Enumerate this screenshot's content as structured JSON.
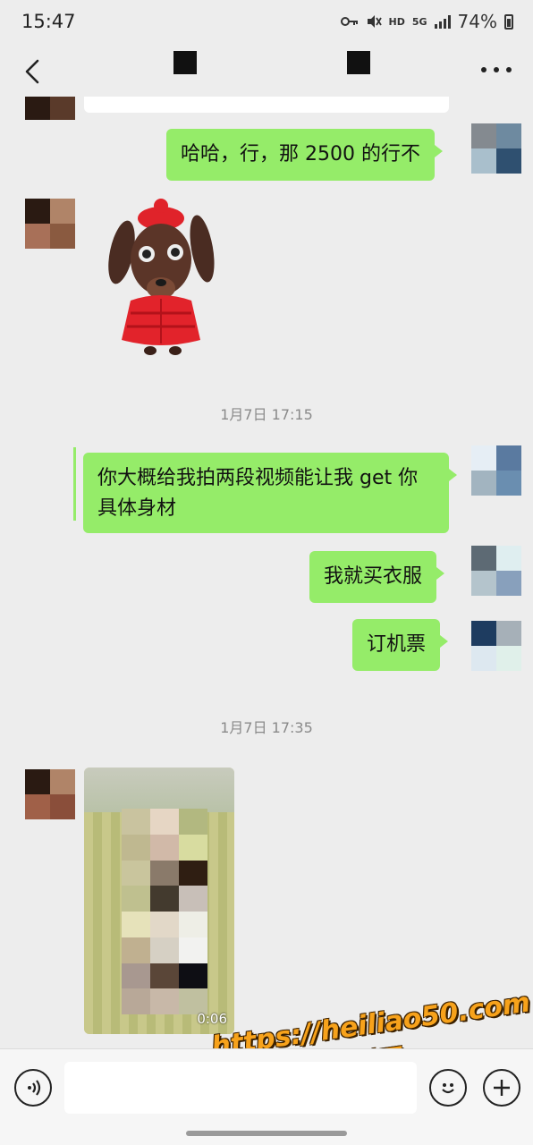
{
  "status_bar": {
    "time": "15:47",
    "hd": "HD",
    "net": "5G",
    "battery": "74%"
  },
  "nav": {
    "back_icon": "chevron-left-icon",
    "more_icon": "more-dots-icon"
  },
  "messages": [
    {
      "type": "text",
      "side": "sent",
      "text": "哈哈，行，那 2500 的行不"
    },
    {
      "type": "sticker",
      "side": "received",
      "description_icon": "dog-in-red-jacket-sticker"
    },
    {
      "type": "timestamp",
      "text": "1月7日 17:15"
    },
    {
      "type": "text",
      "side": "sent",
      "text": "你大概给我拍两段视频能让我 get 你具体身材"
    },
    {
      "type": "text",
      "side": "sent",
      "text": "我就买衣服"
    },
    {
      "type": "text",
      "side": "sent",
      "text": "订机票"
    },
    {
      "type": "timestamp",
      "text": "1月7日 17:35"
    },
    {
      "type": "video",
      "side": "received",
      "duration": "0:06"
    }
  ],
  "input_bar": {
    "voice_icon": "voice-icon",
    "emoji_icon": "emoji-icon",
    "plus_icon": "plus-icon",
    "text_value": ""
  },
  "watermark": {
    "url": "https://heiliao50.com",
    "name": "黑料网"
  },
  "colors": {
    "background": "#ededed",
    "sent_bubble": "#95ec69",
    "timestamp_text": "#8a8a8a"
  }
}
